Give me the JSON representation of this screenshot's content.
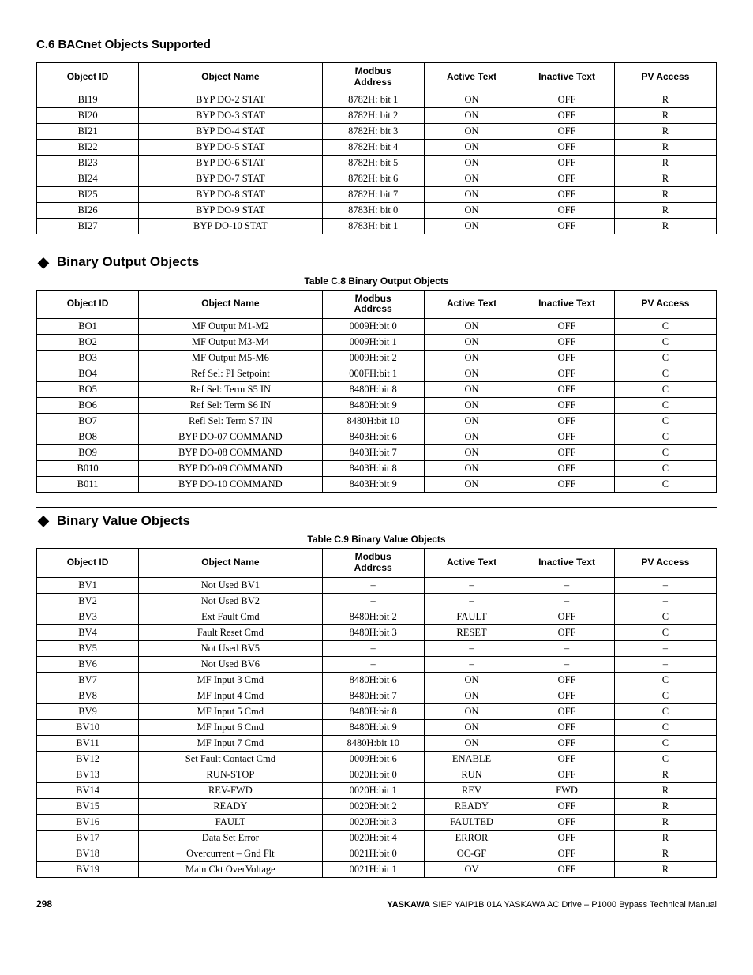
{
  "section_header": "C.6 BACnet Objects Supported",
  "headers": {
    "object_id": "Object ID",
    "object_name": "Object Name",
    "modbus_addr_l1": "Modbus",
    "modbus_addr_l2": "Address",
    "active_text": "Active Text",
    "inactive_text": "Inactive Text",
    "pv_access": "PV Access"
  },
  "table1_rows": [
    {
      "id": "BI19",
      "name": "BYP DO-2 STAT",
      "mod": "8782H: bit 1",
      "act": "ON",
      "inact": "OFF",
      "pv": "R"
    },
    {
      "id": "BI20",
      "name": "BYP DO-3 STAT",
      "mod": "8782H: bit 2",
      "act": "ON",
      "inact": "OFF",
      "pv": "R"
    },
    {
      "id": "BI21",
      "name": "BYP DO-4 STAT",
      "mod": "8782H: bit 3",
      "act": "ON",
      "inact": "OFF",
      "pv": "R"
    },
    {
      "id": "BI22",
      "name": "BYP DO-5 STAT",
      "mod": "8782H: bit 4",
      "act": "ON",
      "inact": "OFF",
      "pv": "R"
    },
    {
      "id": "BI23",
      "name": "BYP DO-6 STAT",
      "mod": "8782H: bit 5",
      "act": "ON",
      "inact": "OFF",
      "pv": "R"
    },
    {
      "id": "BI24",
      "name": "BYP DO-7 STAT",
      "mod": "8782H: bit 6",
      "act": "ON",
      "inact": "OFF",
      "pv": "R"
    },
    {
      "id": "BI25",
      "name": "BYP DO-8 STAT",
      "mod": "8782H: bit 7",
      "act": "ON",
      "inact": "OFF",
      "pv": "R"
    },
    {
      "id": "BI26",
      "name": "BYP DO-9 STAT",
      "mod": "8783H: bit 0",
      "act": "ON",
      "inact": "OFF",
      "pv": "R"
    },
    {
      "id": "BI27",
      "name": "BYP DO-10 STAT",
      "mod": "8783H: bit 1",
      "act": "ON",
      "inact": "OFF",
      "pv": "R"
    }
  ],
  "sub_binary_output": "Binary Output Objects",
  "caption_c8": "Table C.8  Binary Output Objects",
  "table2_rows": [
    {
      "id": "BO1",
      "name": "MF Output M1-M2",
      "mod": "0009H:bit 0",
      "act": "ON",
      "inact": "OFF",
      "pv": "C"
    },
    {
      "id": "BO2",
      "name": "MF Output M3-M4",
      "mod": "0009H:bit 1",
      "act": "ON",
      "inact": "OFF",
      "pv": "C"
    },
    {
      "id": "BO3",
      "name": "MF Output M5-M6",
      "mod": "0009H:bit 2",
      "act": "ON",
      "inact": "OFF",
      "pv": "C"
    },
    {
      "id": "BO4",
      "name": "Ref Sel: PI Setpoint",
      "mod": "000FH:bit 1",
      "act": "ON",
      "inact": "OFF",
      "pv": "C"
    },
    {
      "id": "BO5",
      "name": "Ref Sel: Term S5 IN",
      "mod": "8480H:bit 8",
      "act": "ON",
      "inact": "OFF",
      "pv": "C"
    },
    {
      "id": "BO6",
      "name": "Ref Sel: Term S6 IN",
      "mod": "8480H:bit 9",
      "act": "ON",
      "inact": "OFF",
      "pv": "C"
    },
    {
      "id": "BO7",
      "name": "Refl Sel: Term S7 IN",
      "mod": "8480H:bit 10",
      "act": "ON",
      "inact": "OFF",
      "pv": "C"
    },
    {
      "id": "BO8",
      "name": "BYP DO-07 COMMAND",
      "mod": "8403H:bit 6",
      "act": "ON",
      "inact": "OFF",
      "pv": "C"
    },
    {
      "id": "BO9",
      "name": "BYP DO-08 COMMAND",
      "mod": "8403H:bit 7",
      "act": "ON",
      "inact": "OFF",
      "pv": "C"
    },
    {
      "id": "B010",
      "name": "BYP DO-09 COMMAND",
      "mod": "8403H:bit 8",
      "act": "ON",
      "inact": "OFF",
      "pv": "C"
    },
    {
      "id": "B011",
      "name": "BYP DO-10 COMMAND",
      "mod": "8403H:bit 9",
      "act": "ON",
      "inact": "OFF",
      "pv": "C"
    }
  ],
  "sub_binary_value": "Binary Value Objects",
  "caption_c9": "Table C.9  Binary Value Objects",
  "table3_rows": [
    {
      "id": "BV1",
      "name": "Not Used BV1",
      "mod": "–",
      "act": "–",
      "inact": "–",
      "pv": "–"
    },
    {
      "id": "BV2",
      "name": "Not Used BV2",
      "mod": "–",
      "act": "–",
      "inact": "–",
      "pv": "–"
    },
    {
      "id": "BV3",
      "name": "Ext Fault Cmd",
      "mod": "8480H:bit 2",
      "act": "FAULT",
      "inact": "OFF",
      "pv": "C"
    },
    {
      "id": "BV4",
      "name": "Fault Reset Cmd",
      "mod": "8480H:bit 3",
      "act": "RESET",
      "inact": "OFF",
      "pv": "C"
    },
    {
      "id": "BV5",
      "name": "Not Used BV5",
      "mod": "–",
      "act": "–",
      "inact": "–",
      "pv": "–"
    },
    {
      "id": "BV6",
      "name": "Not Used BV6",
      "mod": "–",
      "act": "–",
      "inact": "–",
      "pv": "–"
    },
    {
      "id": "BV7",
      "name": "MF Input 3 Cmd",
      "mod": "8480H:bit 6",
      "act": "ON",
      "inact": "OFF",
      "pv": "C"
    },
    {
      "id": "BV8",
      "name": "MF Input 4 Cmd",
      "mod": "8480H:bit 7",
      "act": "ON",
      "inact": "OFF",
      "pv": "C"
    },
    {
      "id": "BV9",
      "name": "MF Input 5 Cmd",
      "mod": "8480H:bit 8",
      "act": "ON",
      "inact": "OFF",
      "pv": "C"
    },
    {
      "id": "BV10",
      "name": "MF Input 6 Cmd",
      "mod": "8480H:bit 9",
      "act": "ON",
      "inact": "OFF",
      "pv": "C"
    },
    {
      "id": "BV11",
      "name": "MF Input 7 Cmd",
      "mod": "8480H:bit 10",
      "act": "ON",
      "inact": "OFF",
      "pv": "C"
    },
    {
      "id": "BV12",
      "name": "Set Fault Contact Cmd",
      "mod": "0009H:bit 6",
      "act": "ENABLE",
      "inact": "OFF",
      "pv": "C"
    },
    {
      "id": "BV13",
      "name": "RUN-STOP",
      "mod": "0020H:bit 0",
      "act": "RUN",
      "inact": "OFF",
      "pv": "R"
    },
    {
      "id": "BV14",
      "name": "REV-FWD",
      "mod": "0020H:bit 1",
      "act": "REV",
      "inact": "FWD",
      "pv": "R"
    },
    {
      "id": "BV15",
      "name": "READY",
      "mod": "0020H:bit 2",
      "act": "READY",
      "inact": "OFF",
      "pv": "R"
    },
    {
      "id": "BV16",
      "name": "FAULT",
      "mod": "0020H:bit 3",
      "act": "FAULTED",
      "inact": "OFF",
      "pv": "R"
    },
    {
      "id": "BV17",
      "name": "Data Set Error",
      "mod": "0020H:bit 4",
      "act": "ERROR",
      "inact": "OFF",
      "pv": "R"
    },
    {
      "id": "BV18",
      "name": "Overcurrent – Gnd Flt",
      "mod": "0021H:bit 0",
      "act": "OC-GF",
      "inact": "OFF",
      "pv": "R"
    },
    {
      "id": "BV19",
      "name": "Main Ckt OverVoltage",
      "mod": "0021H:bit 1",
      "act": "OV",
      "inact": "OFF",
      "pv": "R"
    }
  ],
  "footer": {
    "page": "298",
    "brand": "YASKAWA",
    "manual": " SIEP YAIP1B 01A YASKAWA AC Drive – P1000 Bypass Technical Manual"
  }
}
